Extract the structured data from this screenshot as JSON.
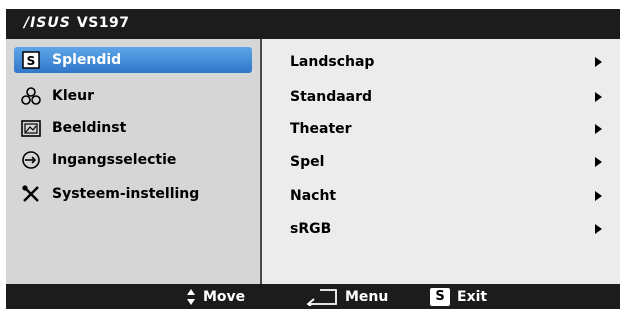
{
  "header": {
    "brand": "/ISUS",
    "model": "VS197"
  },
  "menu": {
    "items": [
      {
        "label": "Splendid",
        "icon": "splendid-s-icon",
        "selected": true
      },
      {
        "label": "Kleur",
        "icon": "color-flask-icon",
        "selected": false
      },
      {
        "label": "Beeldinst",
        "icon": "picture-icon",
        "selected": false
      },
      {
        "label": "Ingangsselectie",
        "icon": "input-source-icon",
        "selected": false
      },
      {
        "label": "Systeem-instelling",
        "icon": "tools-icon",
        "selected": false
      }
    ]
  },
  "submenu": {
    "items": [
      {
        "label": "Landschap"
      },
      {
        "label": "Standaard"
      },
      {
        "label": "Theater"
      },
      {
        "label": "Spel"
      },
      {
        "label": "Nacht"
      },
      {
        "label": "sRGB"
      }
    ]
  },
  "footer": {
    "move": "Move",
    "menu": "Menu",
    "exit_key": "S",
    "exit": "Exit"
  },
  "colors": {
    "title_bg": "#1c1c1c",
    "selected_bg": "#3f8ad8",
    "left_bg": "#d6d6d6",
    "right_bg": "#ececec"
  }
}
